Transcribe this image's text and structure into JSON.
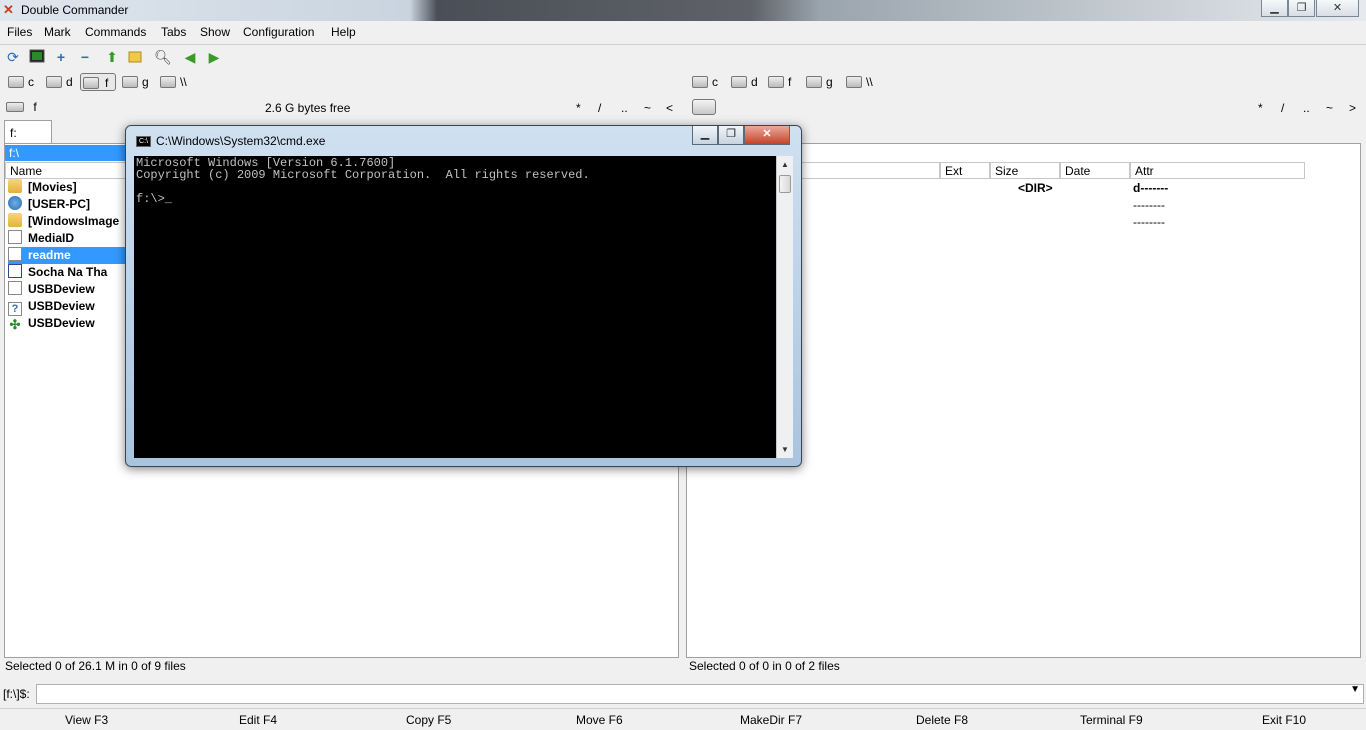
{
  "window": {
    "title": "Double Commander",
    "minimize": "▁",
    "maximize": "❐",
    "close": "✕"
  },
  "menu": [
    "Files",
    "Mark",
    "Commands",
    "Tabs",
    "Show",
    "Configuration",
    "Help"
  ],
  "toolbar": [
    "refresh-icon",
    "terminal-icon",
    "plus-icon",
    "minus-icon",
    "up-folder-icon",
    "folder-info-icon",
    "search-icon",
    "back-arrow-icon",
    "forward-arrow-icon"
  ],
  "left": {
    "drives": [
      "c",
      "d",
      "f",
      "g",
      "\\\\"
    ],
    "drive_label": "f",
    "free": "2.6 G bytes free",
    "nav": [
      "*",
      "/",
      "..",
      "~",
      "<"
    ],
    "tab": "f:",
    "path": "f:\\",
    "col_name": "Name",
    "files": [
      {
        "name": "[Movies]",
        "icon": "folder"
      },
      {
        "name": "[USER-PC]",
        "icon": "network"
      },
      {
        "name": "[WindowsImage",
        "icon": "folder"
      },
      {
        "name": "MediaID",
        "icon": "doc"
      },
      {
        "name": "readme",
        "icon": "doc"
      },
      {
        "name": "Socha Na Tha",
        "icon": "media"
      },
      {
        "name": "USBDeview",
        "icon": "doc"
      },
      {
        "name": "USBDeview",
        "icon": "help"
      },
      {
        "name": "USBDeview",
        "icon": "usb"
      }
    ],
    "status": "Selected 0 of 26.1 M in 0 of 9 files"
  },
  "right": {
    "drives": [
      "c",
      "d",
      "f",
      "g",
      "\\\\"
    ],
    "nav": [
      "*",
      "/",
      "..",
      "~",
      ">"
    ],
    "cols": [
      "Ext",
      "Size",
      "Date",
      "Attr"
    ],
    "rows": [
      {
        "size": "<DIR>",
        "attr": "d-------"
      },
      {
        "size": "",
        "attr": "--------"
      },
      {
        "size": "",
        "attr": "--------"
      }
    ],
    "status": "Selected 0 of 0 in 0 of 2 files"
  },
  "cmdline": {
    "prompt": "[f:\\]$:",
    "dropdown": "▼"
  },
  "fkeys": [
    "View F3",
    "Edit F4",
    "Copy F5",
    "Move F6",
    "MakeDir F7",
    "Delete F8",
    "Terminal F9",
    "Exit F10"
  ],
  "cmd": {
    "title": "C:\\Windows\\System32\\cmd.exe",
    "icon_text": "C:\\",
    "lines": [
      "Microsoft Windows [Version 6.1.7600]",
      "Copyright (c) 2009 Microsoft Corporation.  All rights reserved.",
      "",
      "f:\\>_"
    ],
    "scroll_up": "▲",
    "scroll_down": "▼"
  },
  "colors": {
    "selection": "#3399ff",
    "pathbar": "#3399ff",
    "console_bg": "#000000",
    "console_fg": "#c0c0c0"
  }
}
